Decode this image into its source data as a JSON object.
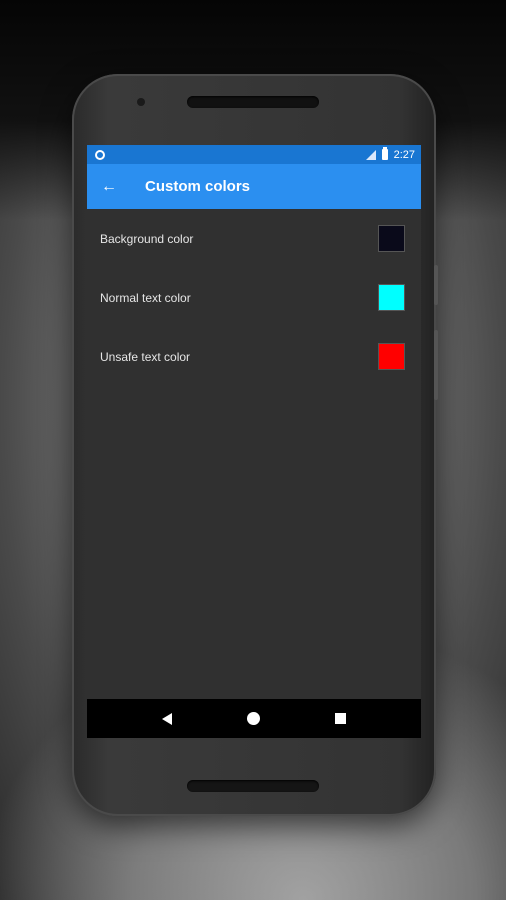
{
  "status_bar": {
    "time": "2:27",
    "icons": [
      "notification-ring-icon",
      "signal-icon",
      "battery-icon"
    ]
  },
  "app_bar": {
    "back_icon": "arrow-back-icon",
    "title": "Custom colors",
    "color": "#2b8ff0"
  },
  "settings": [
    {
      "label": "Background color",
      "color": "#0a0a1a"
    },
    {
      "label": "Normal text color",
      "color": "#00ffff"
    },
    {
      "label": "Unsafe text color",
      "color": "#ff0000"
    }
  ],
  "nav_bar": {
    "icons": [
      "nav-back-icon",
      "nav-home-icon",
      "nav-recent-apps-icon"
    ]
  }
}
